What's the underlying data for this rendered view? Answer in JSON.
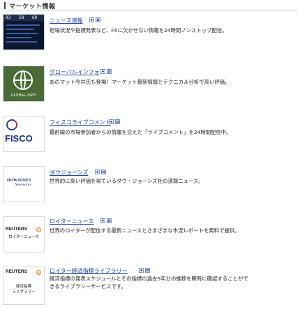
{
  "header": {
    "title": "マーケット情報"
  },
  "items": [
    {
      "link": "ニュース速報",
      "desc": "相場状況や指標発表など、FXに欠かせない情報を24時間ノンストップ配信。",
      "thumb": {
        "nums": [
          "93",
          "58",
          "69"
        ]
      }
    },
    {
      "link": "グローバルインフォ",
      "desc": "あのマット今井氏も登場！マーケット最新情報とテクニカル分析で高い評価。",
      "thumb": {
        "caption": "GLOBAL-INFO"
      }
    },
    {
      "link": "フィスコライブコメント",
      "desc": "最前線の市場参加者からの情報を交えた「ライブコメント」を24時間配信中。",
      "thumb": {
        "brand": "FISCO"
      }
    },
    {
      "link": "ダウジョーンズ",
      "desc": "世界的に高い評価を得ているダウ・ジョーンズ社の速報ニュース。",
      "thumb": {
        "brand_top": "DOWJONES",
        "brand_bottom": "Newswires"
      }
    },
    {
      "link": "ロイターニュース",
      "desc": "世界のロイターが配信する最新ニュースとさまざまな市況レポートを無料で提供。",
      "thumb": {
        "brand": "REUTERS",
        "sub": "ロイターニュース"
      }
    },
    {
      "link": "ロイター経済指標ライブラリー",
      "desc_lines": [
        "経済指標の発表スケジュールとその指標の過去5年分の推移を瞬時に確認することがで",
        "きるライブラリーサービスです。"
      ],
      "thumb": {
        "brand": "REUTERS",
        "sub1": "経済指標",
        "sub2": "ライブラリー"
      }
    }
  ]
}
